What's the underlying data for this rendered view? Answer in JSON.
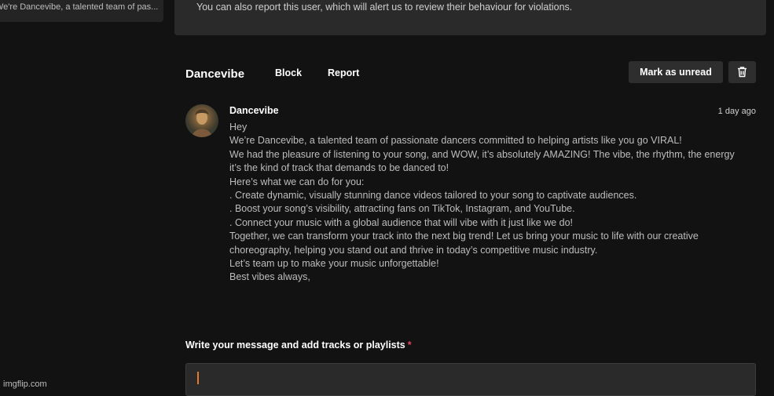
{
  "sidebar": {
    "preview_snippet": "We're Dancevibe, a talented team of pas..."
  },
  "notice": {
    "text": "You can also report this user, which will alert us to review their behaviour for violations."
  },
  "header": {
    "name": "Dancevibe",
    "block_label": "Block",
    "report_label": "Report",
    "mark_unread_label": "Mark as unread",
    "delete_icon": "trash-icon"
  },
  "message": {
    "sender": "Dancevibe",
    "time": "1 day ago",
    "lines": [
      "Hey",
      "We’re Dancevibe, a talented team of passionate dancers committed to helping artists like you go VIRAL!",
      "We had the pleasure of listening to your song, and WOW, it’s absolutely AMAZING! The vibe, the rhythm, the energy",
      "it’s the kind of track that demands to be danced to!",
      "Here’s what we can do for you:",
      ". Create dynamic, visually stunning dance videos tailored to your song to captivate audiences.",
      ". Boost your song’s visibility, attracting fans on TikTok, Instagram, and YouTube.",
      ". Connect your music with a global audience that will vibe with it just like we do!",
      "Together, we can transform your track into the next big trend! Let us bring your music to life with our creative",
      "choreography, helping you stand out and thrive in today’s competitive music industry.",
      "Let’s team up to make your music unforgettable!",
      "Best vibes always,"
    ]
  },
  "compose": {
    "label": "Write your message and add tracks or playlists",
    "required_mark": "*"
  },
  "watermark": "imgflip.com",
  "colors": {
    "background": "#121212",
    "panel": "#2a2a2a",
    "required": "#e0425a",
    "caret": "#e07a2e"
  }
}
